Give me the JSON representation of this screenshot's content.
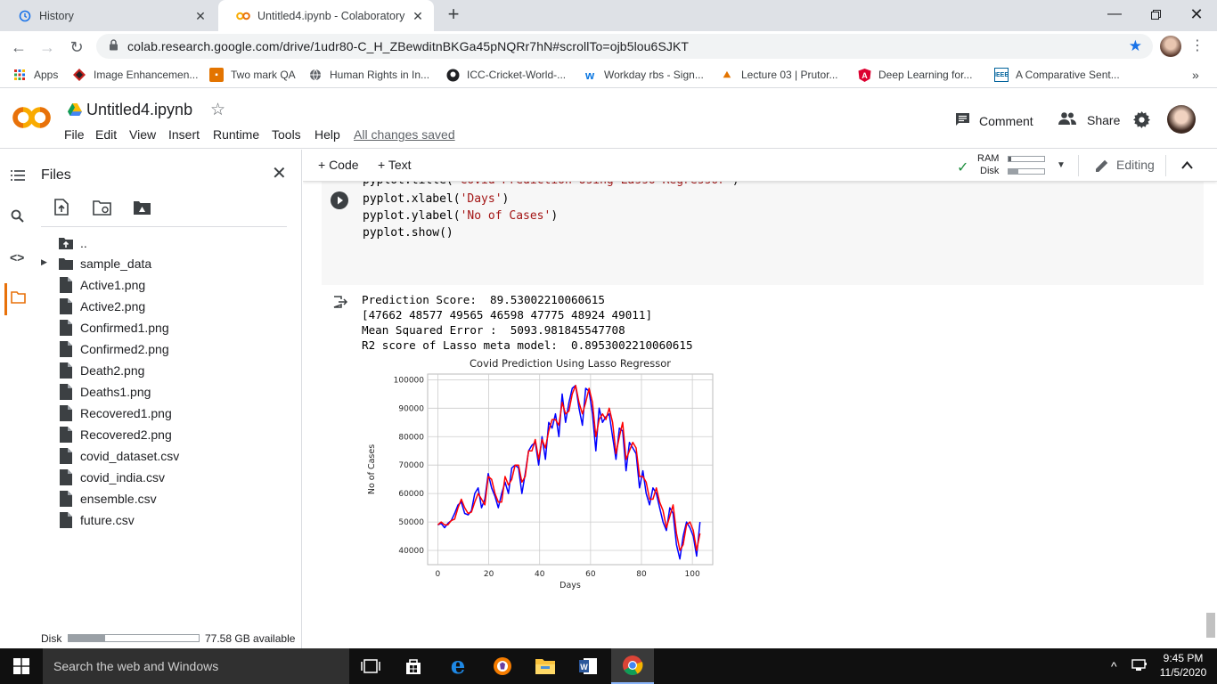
{
  "browser": {
    "tabs": [
      {
        "title": "History",
        "icon": "history-icon"
      },
      {
        "title": "Untitled4.ipynb - Colaboratory",
        "icon": "colab-icon"
      }
    ],
    "url": "colab.research.google.com/drive/1udr80-C_H_ZBewditnBKGa45pNQRr7hN#scrollTo=ojb5lou6SJKT",
    "bookmarks": [
      "Apps",
      "Image Enhancemen...",
      "Two mark QA",
      "Human Rights in In...",
      "ICC-Cricket-World-...",
      "Workday rbs - Sign...",
      "Lecture 03 | Prutor...",
      "Deep Learning for...",
      "A Comparative Sent..."
    ]
  },
  "colab": {
    "title": "Untitled4.ipynb",
    "menu": [
      "File",
      "Edit",
      "View",
      "Insert",
      "Runtime",
      "Tools",
      "Help"
    ],
    "save_status": "All changes saved",
    "comment_label": "Comment",
    "share_label": "Share",
    "add_code_label": "+ Code",
    "add_text_label": "+ Text",
    "ram_label": "RAM",
    "disk_label": "Disk",
    "editing_label": "Editing"
  },
  "files_panel": {
    "title": "Files",
    "parent_dir": "..",
    "folder": "sample_data",
    "files": [
      "Active1.png",
      "Active2.png",
      "Confirmed1.png",
      "Confirmed2.png",
      "Death2.png",
      "Deaths1.png",
      "Recovered1.png",
      "Recovered2.png",
      "covid_dataset.csv",
      "covid_india.csv",
      "ensemble.csv",
      "future.csv"
    ],
    "disk_label": "Disk",
    "disk_available": "77.58 GB available"
  },
  "cell": {
    "code_lines": [
      {
        "pre": "pyplot.title(",
        "str": "'Covid Prediction Using Lasso Regressor'",
        "post": ")"
      },
      {
        "pre": "pyplot.xlabel(",
        "str": "'Days'",
        "post": ")"
      },
      {
        "pre": "pyplot.ylabel(",
        "str": "'No of Cases'",
        "post": ")"
      },
      {
        "pre": "pyplot.show()",
        "str": "",
        "post": ""
      }
    ],
    "output_lines": [
      "Prediction Score:  89.53002210060615",
      "[47662 48577 49565 46598 47775 48924 49011]",
      "Mean Squared Error :  5093.981845547708",
      "R2 score of Lasso meta model:  0.8953002210060615"
    ]
  },
  "chart_data": {
    "type": "line",
    "title": "Covid Prediction Using Lasso Regressor",
    "xlabel": "Days",
    "ylabel": "No of Cases",
    "xlim": [
      -4,
      108
    ],
    "ylim": [
      35000,
      102000
    ],
    "xticks": [
      0,
      20,
      40,
      60,
      80,
      100
    ],
    "yticks": [
      40000,
      50000,
      60000,
      70000,
      80000,
      90000,
      100000
    ],
    "grid": true,
    "series": [
      {
        "color": "#0000ff",
        "values": [
          49000,
          49500,
          48000,
          49500,
          50500,
          53000,
          56000,
          57000,
          53000,
          52500,
          54000,
          60000,
          62000,
          55000,
          58000,
          67000,
          62000,
          59000,
          55000,
          60000,
          64000,
          60000,
          69000,
          70000,
          69000,
          60000,
          67000,
          75000,
          77000,
          78000,
          70000,
          80000,
          72000,
          85000,
          83000,
          88000,
          80000,
          95000,
          85000,
          92000,
          97000,
          98000,
          90000,
          84000,
          97000,
          96000,
          88000,
          75000,
          90000,
          85000,
          87000,
          88000,
          80000,
          72000,
          83000,
          82000,
          68000,
          78000,
          76000,
          74000,
          62000,
          68000,
          60000,
          56000,
          62000,
          60000,
          55000,
          50000,
          47000,
          55000,
          53000,
          42000,
          37000,
          45000,
          50000,
          48000,
          45000,
          38000,
          50000
        ]
      },
      {
        "color": "#ff0000",
        "values": [
          49000,
          50000,
          49000,
          49000,
          50500,
          51000,
          55000,
          58000,
          55000,
          53000,
          53500,
          57000,
          60000,
          58000,
          56000,
          66000,
          65000,
          60000,
          57000,
          57000,
          66000,
          63000,
          65000,
          70000,
          70000,
          64000,
          66000,
          75000,
          75000,
          79000,
          72000,
          79000,
          76000,
          82000,
          86000,
          86000,
          84000,
          92000,
          88000,
          89000,
          95000,
          98000,
          92000,
          88000,
          92000,
          97000,
          92000,
          80000,
          86000,
          88000,
          86000,
          90000,
          85000,
          74000,
          80000,
          85000,
          72000,
          75000,
          78000,
          76000,
          66000,
          66000,
          64000,
          58000,
          58000,
          62000,
          57000,
          54000,
          48000,
          52000,
          56000,
          46000,
          40000,
          42000,
          49000,
          50000,
          47000,
          40000,
          46000
        ]
      }
    ]
  },
  "taskbar": {
    "search_placeholder": "Search the web and Windows",
    "time": "9:45 PM",
    "date": "11/5/2020"
  }
}
